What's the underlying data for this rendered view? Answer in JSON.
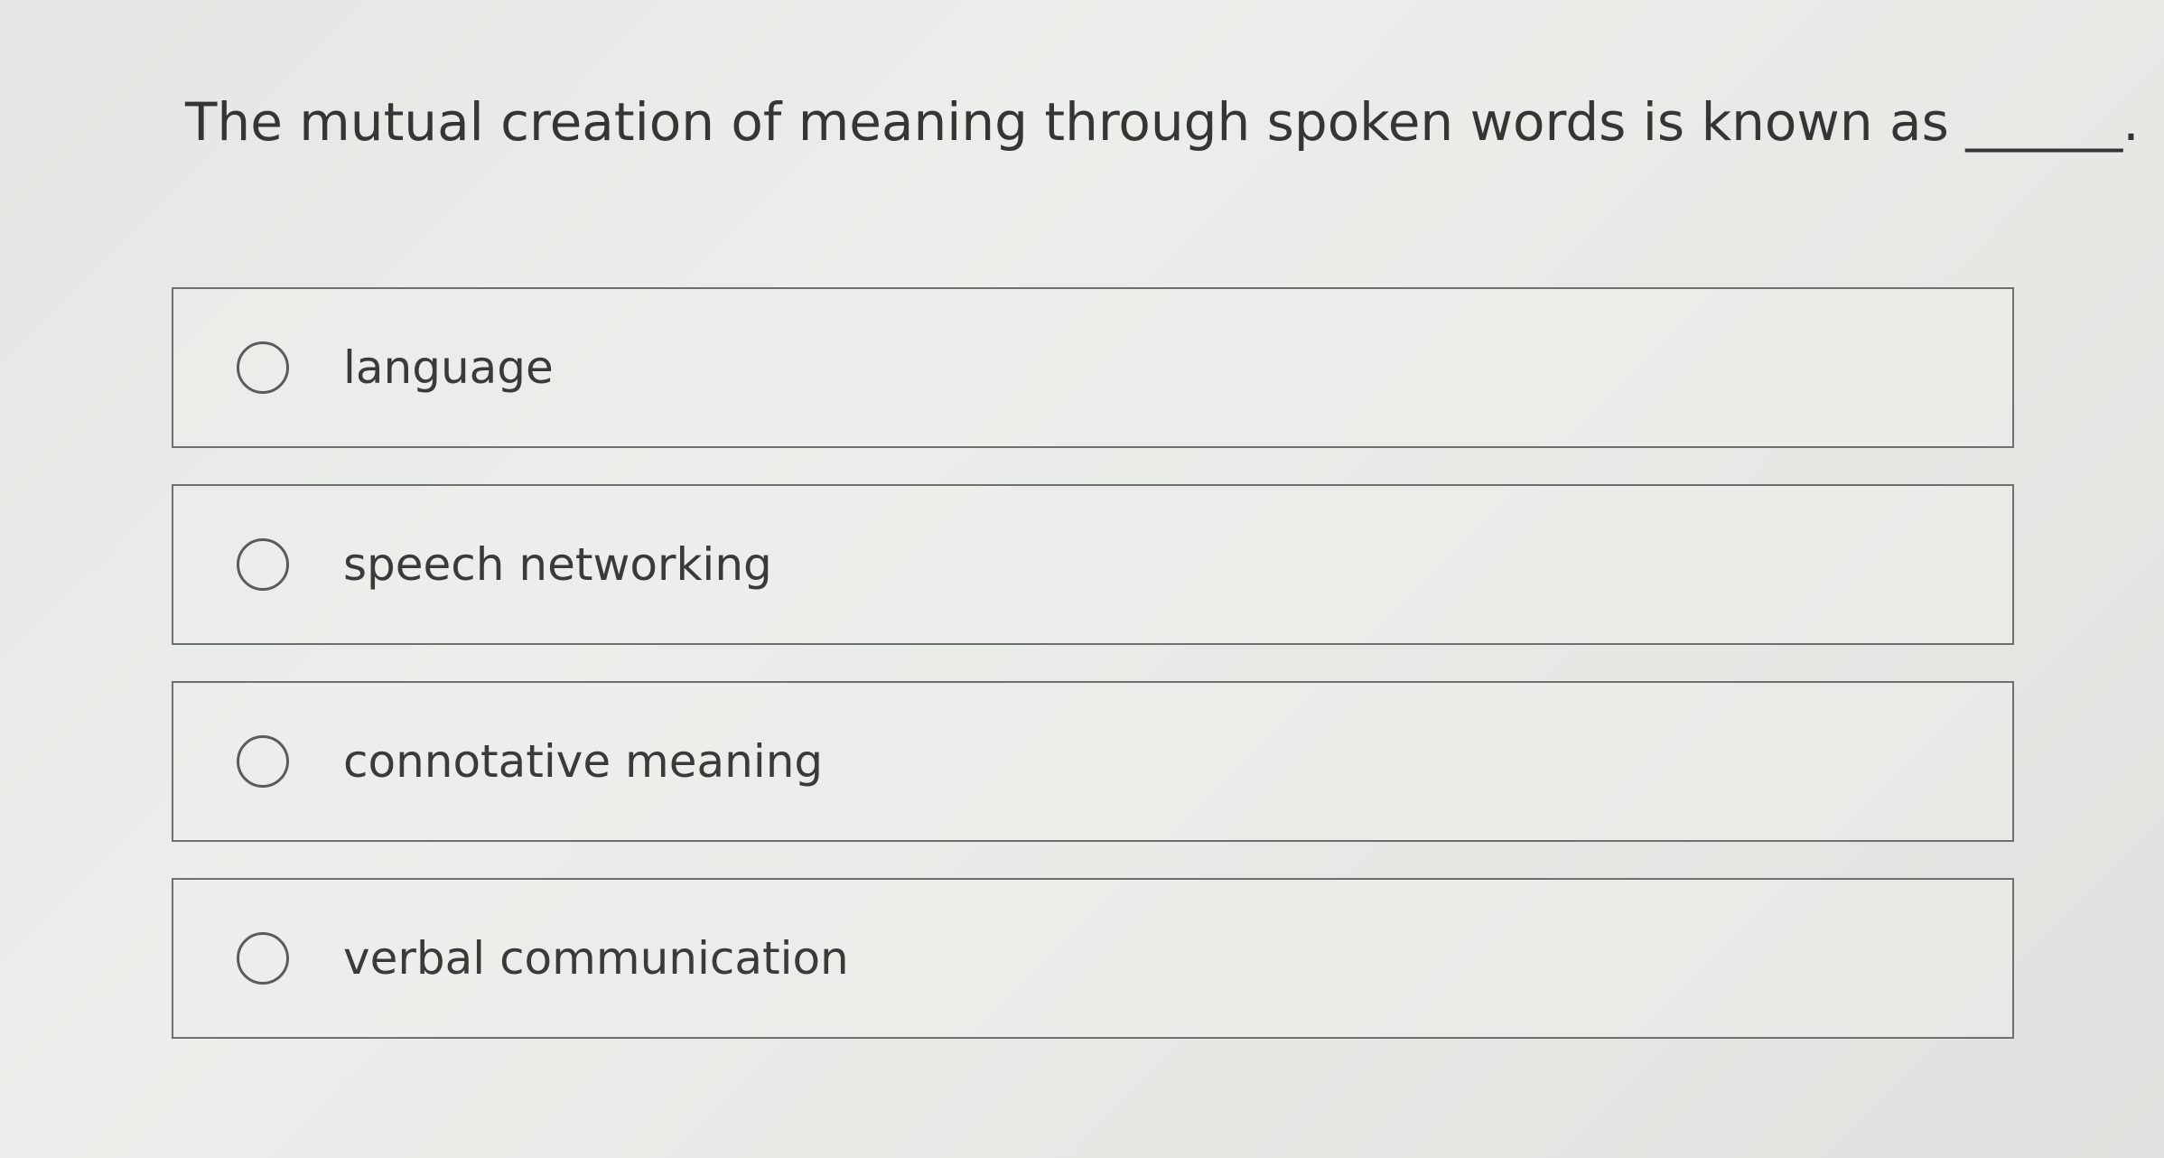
{
  "question": {
    "text": "The mutual creation of meaning through spoken words is known as ______."
  },
  "options": [
    {
      "label": "language",
      "selected": false
    },
    {
      "label": "speech networking",
      "selected": false
    },
    {
      "label": "connotative meaning",
      "selected": false
    },
    {
      "label": "verbal communication",
      "selected": false
    }
  ]
}
